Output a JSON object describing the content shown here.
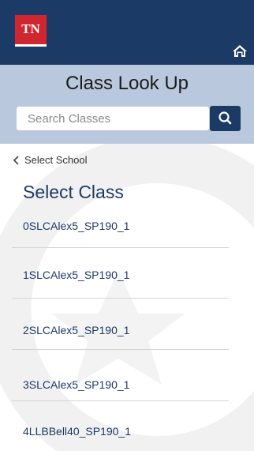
{
  "app": {
    "logo_text": "TN"
  },
  "header": {
    "title": "Class Look Up",
    "search_placeholder": "Search Classes"
  },
  "nav": {
    "back_label": "Select School"
  },
  "content": {
    "section_title": "Select Class",
    "classes": [
      "0SLCAlex5_SP190_1",
      "1SLCAlex5_SP190_1",
      "2SLCAlex5_SP190_1",
      "3SLCAlex5_SP190_1",
      "4LLBBell40_SP190_1"
    ]
  },
  "colors": {
    "topbar": "#1c3a66",
    "header": "#b9c8dc",
    "logo": "#d0262f",
    "accent": "#1c3a66"
  },
  "icons": {
    "home": "home-icon",
    "search": "search-icon",
    "back": "chevron-left-icon"
  }
}
